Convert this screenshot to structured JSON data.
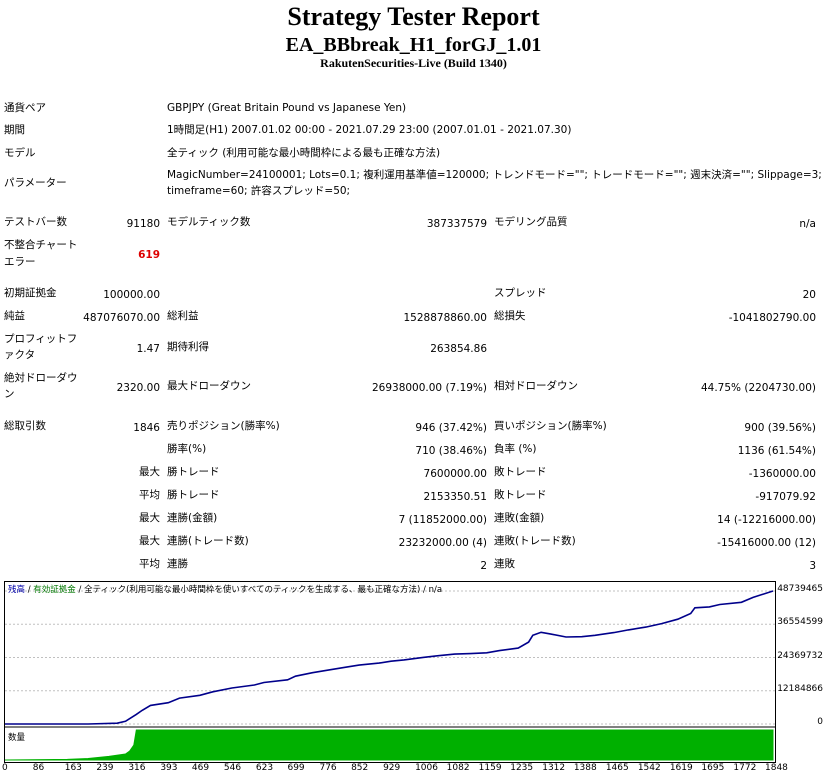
{
  "report": {
    "title": "Strategy Tester Report",
    "ea_name": "EA_BBbreak_H1_forGJ_1.01",
    "server": "RakutenSecurities-Live (Build 1340)"
  },
  "settings": {
    "symbol_label": "通貨ペア",
    "symbol_value": "GBPJPY (Great Britain Pound vs Japanese Yen)",
    "period_label": "期間",
    "period_value": "1時間足(H1) 2007.01.02 00:00 - 2021.07.29 23:00 (2007.01.01 - 2021.07.30)",
    "model_label": "モデル",
    "model_value": "全ティック (利用可能な最小時間枠による最も正確な方法)",
    "params_label": "パラメーター",
    "params_line1": "MagicNumber=24100001; Lots=0.1; 複利運用基準値=120000; トレンドモード=\"\"; トレードモード=\"\"; 週末決済=\"\"; Slippage=3;",
    "params_line2": "timeframe=60; 許容スプレッド=50;"
  },
  "stats": {
    "bars_label": "テストバー数",
    "bars_value": "91180",
    "ticks_label": "モデルティック数",
    "ticks_value": "387337579",
    "quality_label": "モデリング品質",
    "quality_value": "n/a",
    "mismatch_label_1": "不整合チャート",
    "mismatch_label_2": "エラー",
    "mismatch_value": "619",
    "deposit_label": "初期証拠金",
    "deposit_value": "100000.00",
    "spread_label": "スプレッド",
    "spread_value": "20",
    "net_label": "純益",
    "net_value": "487076070.00",
    "gross_profit_label": "総利益",
    "gross_profit_value": "1528878860.00",
    "gross_loss_label": "総損失",
    "gross_loss_value": "-1041802790.00",
    "pf_label_1": "プロフィットフ",
    "pf_label_2": "ァクタ",
    "pf_value": "1.47",
    "expected_label": "期待利得",
    "expected_value": "263854.86",
    "abs_dd_label_1": "絶対ドローダウ",
    "abs_dd_label_2": "ン",
    "abs_dd_value": "2320.00",
    "max_dd_label": "最大ドローダウン",
    "max_dd_value": "26938000.00 (7.19%)",
    "rel_dd_label": "相対ドローダウン",
    "rel_dd_value": "44.75% (2204730.00)",
    "total_trades_label": "総取引数",
    "total_trades_value": "1846",
    "short_label": "売りポジション(勝率%)",
    "short_value": "946 (37.42%)",
    "long_label": "買いポジション(勝率%)",
    "long_value": "900 (39.56%)",
    "win_label": "勝率(%)",
    "win_value": "710 (38.46%)",
    "loss_label": "負率 (%)",
    "loss_value": "1136 (61.54%)",
    "largest_prefix": "最大",
    "largest_win_label": "勝トレード",
    "largest_win_value": "7600000.00",
    "largest_loss_label": "敗トレード",
    "largest_loss_value": "-1360000.00",
    "average_prefix": "平均",
    "avg_win_label": "勝トレード",
    "avg_win_value": "2153350.51",
    "avg_loss_label": "敗トレード",
    "avg_loss_value": "-917079.92",
    "max_prefix_1": "最大",
    "consec_wins_money_label": "連勝(金額)",
    "consec_wins_money_value": "7 (11852000.00)",
    "consec_losses_money_label": "連敗(金額)",
    "consec_losses_money_value": "14 (-12216000.00)",
    "max_prefix_2": "最大",
    "consec_profit_label": "連勝(トレード数)",
    "consec_profit_value": "23232000.00 (4)",
    "consec_loss_label": "連敗(トレード数)",
    "consec_loss_value": "-15416000.00 (12)",
    "avg_prefix_2": "平均",
    "avg_consec_wins_label": "連勝",
    "avg_consec_wins_value": "2",
    "avg_consec_losses_label": "連敗",
    "avg_consec_losses_value": "3"
  },
  "chart_legend": {
    "balance": "残高",
    "sep1": " / ",
    "equity": "有効証拠金",
    "sep2": " / ",
    "model": "全ティック(利用可能な最小時間枠を使いすべてのティックを生成する、最も正確な方法)",
    "sep3": " / ",
    "quality": "n/a",
    "volume": "数量"
  },
  "colors": {
    "balance_line": "#00008b",
    "equity_line": "#00aa00",
    "volume_fill": "#00b000",
    "grid": "#c0c0c0"
  },
  "chart_data": {
    "type": "line",
    "x_ticks": [
      "0",
      "86",
      "163",
      "239",
      "316",
      "393",
      "469",
      "546",
      "623",
      "699",
      "776",
      "852",
      "929",
      "1006",
      "1082",
      "1159",
      "1235",
      "1312",
      "1388",
      "1465",
      "1542",
      "1619",
      "1695",
      "1772",
      "1848"
    ],
    "y_ticks": [
      "48739465",
      "36554599",
      "24369732",
      "12184866",
      "0"
    ],
    "ylim": [
      0,
      48739465
    ],
    "xlim": [
      0,
      1848
    ],
    "series": [
      {
        "name": "残高",
        "x": [
          0,
          200,
          270,
          290,
          316,
          330,
          350,
          393,
          420,
          469,
          500,
          546,
          600,
          623,
          680,
          699,
          740,
          776,
          820,
          852,
          900,
          929,
          960,
          1006,
          1040,
          1082,
          1120,
          1159,
          1190,
          1235,
          1260,
          1270,
          1290,
          1312,
          1350,
          1388,
          1420,
          1465,
          1500,
          1542,
          1580,
          1619,
          1650,
          1660,
          1695,
          1720,
          1772,
          1800,
          1848
        ],
        "y": [
          0,
          0,
          300000,
          1000000,
          3500000,
          5000000,
          6800000,
          7800000,
          9500000,
          10500000,
          11800000,
          13200000,
          14300000,
          15200000,
          16200000,
          17500000,
          18800000,
          19700000,
          20800000,
          21600000,
          22300000,
          23000000,
          23500000,
          24400000,
          25000000,
          25600000,
          25800000,
          26100000,
          26900000,
          27800000,
          30000000,
          32500000,
          33600000,
          33000000,
          31900000,
          32000000,
          32500000,
          33500000,
          34500000,
          35500000,
          36800000,
          38400000,
          40500000,
          42600000,
          42900000,
          43800000,
          44600000,
          46400000,
          48739465
        ]
      }
    ],
    "volume": {
      "name": "数量",
      "x": [
        0,
        150,
        200,
        250,
        290,
        300,
        310,
        316,
        1848
      ],
      "y": [
        0,
        0.02,
        0.05,
        0.12,
        0.2,
        0.3,
        0.5,
        1,
        1
      ]
    }
  }
}
